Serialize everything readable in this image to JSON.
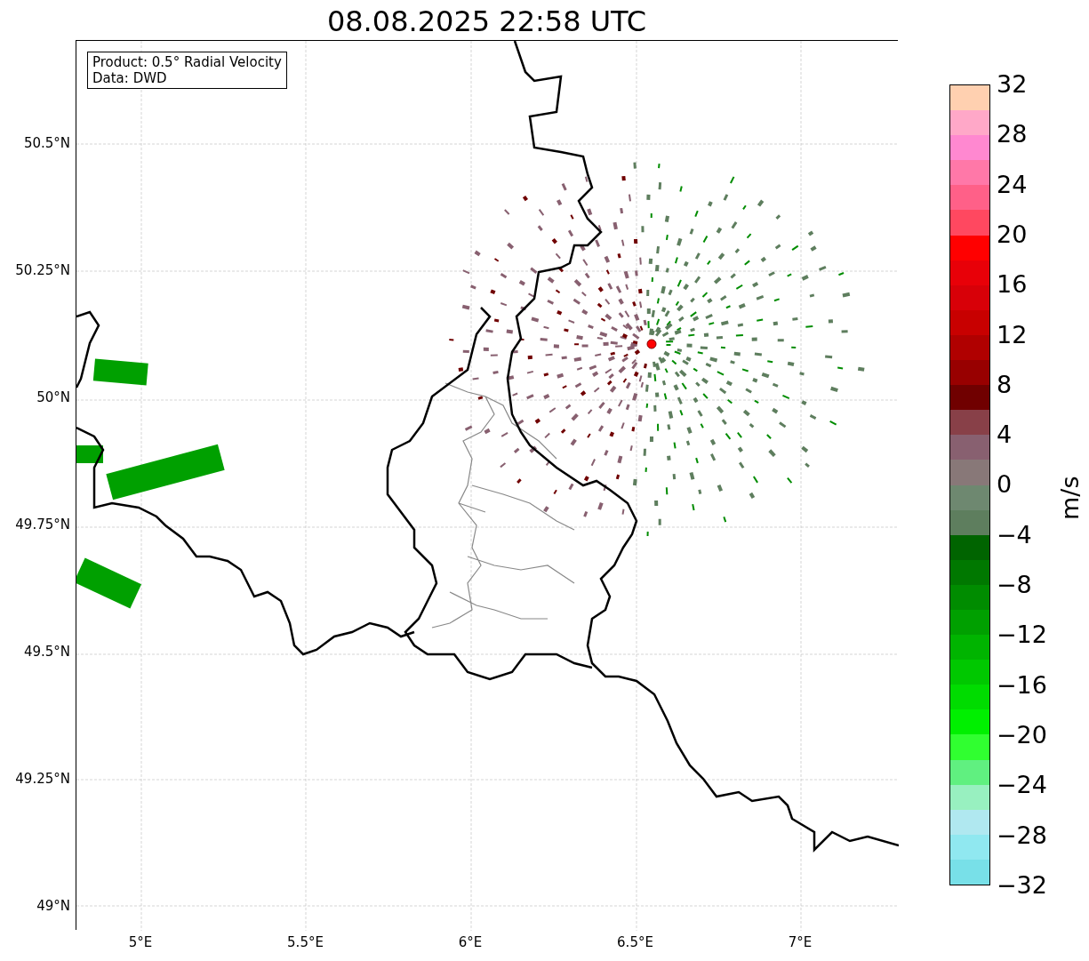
{
  "title": "08.08.2025 22:58 UTC",
  "legend": [
    "Product: 0.5° Radial Velocity",
    "Data: DWD"
  ],
  "map": {
    "yticks": [
      "50.5°N",
      "50.25°N",
      "50°N",
      "49.75°N",
      "49.5°N",
      "49.25°N",
      "49°N"
    ],
    "xticks": [
      "5°E",
      "5.5°E",
      "6°E",
      "6.5°E",
      "7°E"
    ]
  },
  "colorbar": {
    "label": "m/s",
    "ticks": [
      "32",
      "28",
      "24",
      "20",
      "16",
      "12",
      "8",
      "4",
      "0",
      "−4",
      "−8",
      "−12",
      "−16",
      "−20",
      "−24",
      "−28",
      "−32"
    ],
    "bands": [
      {
        "color": "#ffd0b0"
      },
      {
        "color": "#ffa8c8"
      },
      {
        "color": "#ff88d0"
      },
      {
        "color": "#ff78a8"
      },
      {
        "color": "#ff6088"
      },
      {
        "color": "#ff4860"
      },
      {
        "color": "#ff0000"
      },
      {
        "color": "#e80008"
      },
      {
        "color": "#d80008"
      },
      {
        "color": "#c80000"
      },
      {
        "color": "#b00000"
      },
      {
        "color": "#980000"
      },
      {
        "color": "#700000"
      },
      {
        "color": "#884048"
      },
      {
        "color": "#886070"
      },
      {
        "color": "#887878"
      },
      {
        "color": "#6e8870"
      },
      {
        "color": "#5e7e5e"
      },
      {
        "color": "#006400"
      },
      {
        "color": "#007800"
      },
      {
        "color": "#008c00"
      },
      {
        "color": "#00a000"
      },
      {
        "color": "#00b400"
      },
      {
        "color": "#00c800"
      },
      {
        "color": "#00dc00"
      },
      {
        "color": "#00f000"
      },
      {
        "color": "#30ff30"
      },
      {
        "color": "#60f080"
      },
      {
        "color": "#98f0c0"
      },
      {
        "color": "#b0e8f0"
      },
      {
        "color": "#90e8f0"
      },
      {
        "color": "#78e0e8"
      }
    ]
  }
}
